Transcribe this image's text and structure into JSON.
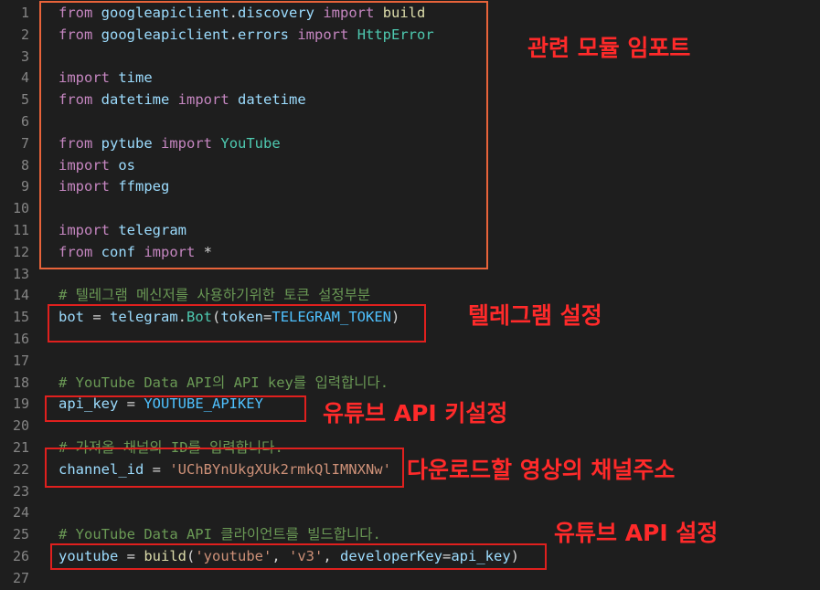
{
  "editor": {
    "lines": [
      {
        "n": "1",
        "tokens": [
          [
            "kw",
            "from"
          ],
          [
            "op",
            " "
          ],
          [
            "id",
            "googleapiclient"
          ],
          [
            "op",
            "."
          ],
          [
            "id",
            "discovery"
          ],
          [
            "op",
            " "
          ],
          [
            "kw",
            "import"
          ],
          [
            "op",
            " "
          ],
          [
            "fn",
            "build"
          ]
        ]
      },
      {
        "n": "2",
        "tokens": [
          [
            "kw",
            "from"
          ],
          [
            "op",
            " "
          ],
          [
            "id",
            "googleapiclient"
          ],
          [
            "op",
            "."
          ],
          [
            "id",
            "errors"
          ],
          [
            "op",
            " "
          ],
          [
            "kw",
            "import"
          ],
          [
            "op",
            " "
          ],
          [
            "cls",
            "HttpError"
          ]
        ]
      },
      {
        "n": "3",
        "tokens": []
      },
      {
        "n": "4",
        "tokens": [
          [
            "kw",
            "import"
          ],
          [
            "op",
            " "
          ],
          [
            "id",
            "time"
          ]
        ]
      },
      {
        "n": "5",
        "tokens": [
          [
            "kw",
            "from"
          ],
          [
            "op",
            " "
          ],
          [
            "id",
            "datetime"
          ],
          [
            "op",
            " "
          ],
          [
            "kw",
            "import"
          ],
          [
            "op",
            " "
          ],
          [
            "id",
            "datetime"
          ]
        ]
      },
      {
        "n": "6",
        "tokens": []
      },
      {
        "n": "7",
        "tokens": [
          [
            "kw",
            "from"
          ],
          [
            "op",
            " "
          ],
          [
            "id",
            "pytube"
          ],
          [
            "op",
            " "
          ],
          [
            "kw",
            "import"
          ],
          [
            "op",
            " "
          ],
          [
            "cls",
            "YouTube"
          ]
        ]
      },
      {
        "n": "8",
        "tokens": [
          [
            "kw",
            "import"
          ],
          [
            "op",
            " "
          ],
          [
            "id",
            "os"
          ]
        ]
      },
      {
        "n": "9",
        "tokens": [
          [
            "kw",
            "import"
          ],
          [
            "op",
            " "
          ],
          [
            "id",
            "ffmpeg"
          ]
        ]
      },
      {
        "n": "10",
        "tokens": []
      },
      {
        "n": "11",
        "tokens": [
          [
            "kw",
            "import"
          ],
          [
            "op",
            " "
          ],
          [
            "id",
            "telegram"
          ]
        ]
      },
      {
        "n": "12",
        "tokens": [
          [
            "kw",
            "from"
          ],
          [
            "op",
            " "
          ],
          [
            "id",
            "conf"
          ],
          [
            "op",
            " "
          ],
          [
            "kw",
            "import"
          ],
          [
            "op",
            " *"
          ]
        ]
      },
      {
        "n": "13",
        "tokens": []
      },
      {
        "n": "14",
        "tokens": [
          [
            "cmt",
            "# 텔레그램 메신저를 사용하기위한 토큰 설정부분"
          ]
        ]
      },
      {
        "n": "15",
        "tokens": [
          [
            "id",
            "bot"
          ],
          [
            "op",
            " = "
          ],
          [
            "id",
            "telegram"
          ],
          [
            "op",
            "."
          ],
          [
            "cls",
            "Bot"
          ],
          [
            "op",
            "("
          ],
          [
            "id",
            "token"
          ],
          [
            "op",
            "="
          ],
          [
            "const",
            "TELEGRAM_TOKEN"
          ],
          [
            "op",
            ")"
          ]
        ]
      },
      {
        "n": "16",
        "tokens": []
      },
      {
        "n": "17",
        "tokens": []
      },
      {
        "n": "18",
        "tokens": [
          [
            "cmt",
            "# YouTube Data API의 API key를 입력합니다."
          ]
        ]
      },
      {
        "n": "19",
        "tokens": [
          [
            "id",
            "api_key"
          ],
          [
            "op",
            " = "
          ],
          [
            "const",
            "YOUTUBE_APIKEY"
          ]
        ]
      },
      {
        "n": "20",
        "tokens": []
      },
      {
        "n": "21",
        "tokens": [
          [
            "cmt",
            "# 가져올 채널의 ID를 입력합니다."
          ]
        ]
      },
      {
        "n": "22",
        "tokens": [
          [
            "id",
            "channel_id"
          ],
          [
            "op",
            " = "
          ],
          [
            "str",
            "'UChBYnUkgXUk2rmkQlIMNXNw'"
          ]
        ]
      },
      {
        "n": "23",
        "tokens": []
      },
      {
        "n": "24",
        "tokens": []
      },
      {
        "n": "25",
        "tokens": [
          [
            "cmt",
            "# YouTube Data API 클라이언트를 빌드합니다."
          ]
        ]
      },
      {
        "n": "26",
        "tokens": [
          [
            "id",
            "youtube"
          ],
          [
            "op",
            " = "
          ],
          [
            "fn",
            "build"
          ],
          [
            "op",
            "("
          ],
          [
            "str",
            "'youtube'"
          ],
          [
            "op",
            ", "
          ],
          [
            "str",
            "'v3'"
          ],
          [
            "op",
            ", "
          ],
          [
            "id",
            "developerKey"
          ],
          [
            "op",
            "="
          ],
          [
            "id",
            "api_key"
          ],
          [
            "op",
            ")"
          ]
        ]
      },
      {
        "n": "27",
        "tokens": []
      }
    ]
  },
  "annotations": {
    "imports": "관련 모듈 임포트",
    "telegram": "텔레그램 설정",
    "api_key": "유튜브 API 키설정",
    "channel": "다운로드할 영상의 채널주소",
    "youtube": "유튜브 API 설정"
  },
  "colors": {
    "background": "#1e1e1e",
    "annotation": "#ff2a2a",
    "box": "#e0201e",
    "import_box": "#e8633a"
  }
}
